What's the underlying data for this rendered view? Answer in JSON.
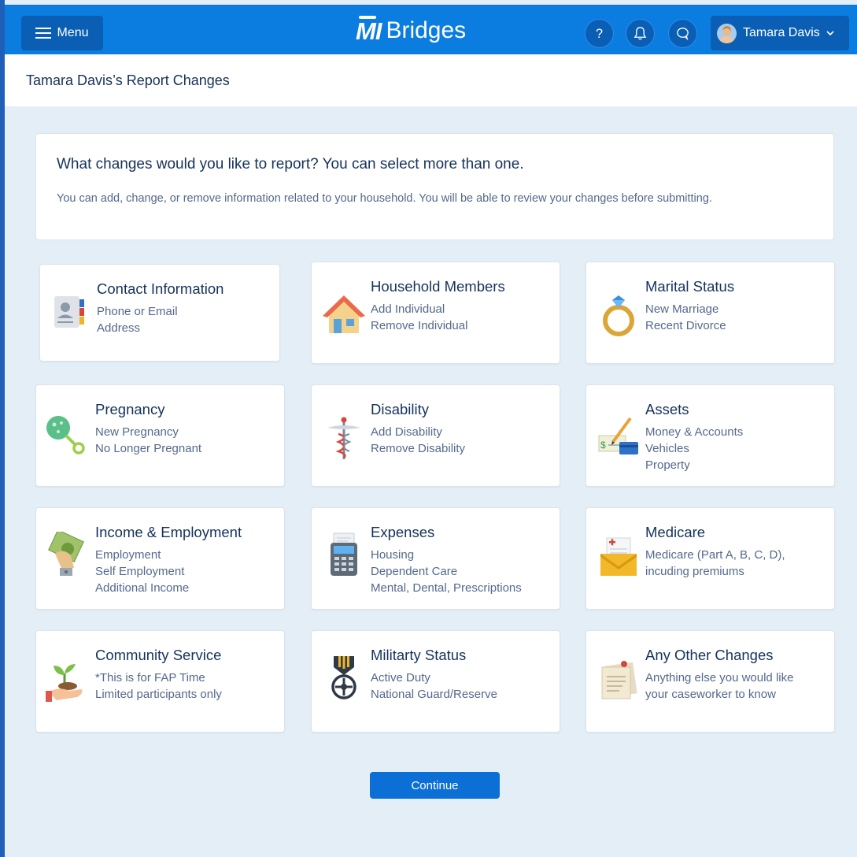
{
  "header": {
    "menu_label": "Menu",
    "logo_mark": "MI",
    "logo_word": "Bridges",
    "help_icon": "question-icon",
    "notifications_icon": "bell-icon",
    "chat_icon": "chat-icon",
    "user_name": "Tamara Davis"
  },
  "page": {
    "title": "Tamara Davis’s Report Changes"
  },
  "intro": {
    "heading": "What changes would you like to report? You can select more than one.",
    "body": "You can add, change, or remove information related to your household. You will be able to review your changes before submitting."
  },
  "cards": [
    {
      "title": "Contact Information",
      "lines": [
        "Phone or Email",
        "Address"
      ],
      "icon": "contact-card-icon"
    },
    {
      "title": "Household Members",
      "lines": [
        "Add Individual",
        "Remove Individual"
      ],
      "icon": "house-icon"
    },
    {
      "title": "Marital Status",
      "lines": [
        "New Marriage",
        "Recent Divorce"
      ],
      "icon": "ring-icon"
    },
    {
      "title": "Pregnancy",
      "lines": [
        "New Pregnancy",
        "No Longer Pregnant"
      ],
      "icon": "baby-rattle-icon"
    },
    {
      "title": "Disability",
      "lines": [
        "Add Disability",
        "Remove Disability"
      ],
      "icon": "caduceus-icon"
    },
    {
      "title": "Assets",
      "lines": [
        "Money & Accounts",
        "Vehicles",
        "Property"
      ],
      "icon": "check-and-card-icon"
    },
    {
      "title": "Income & Employment",
      "lines": [
        "Employment",
        "Self Employment",
        "Additional Income"
      ],
      "icon": "money-hand-icon"
    },
    {
      "title": "Expenses",
      "lines": [
        "Housing",
        "Dependent Care",
        "Mental, Dental, Prescriptions"
      ],
      "icon": "payment-terminal-icon"
    },
    {
      "title": "Medicare",
      "lines": [
        "Medicare (Part A, B, C, D),",
        "incuding premiums"
      ],
      "icon": "medical-envelope-icon"
    },
    {
      "title": "Community Service",
      "lines": [
        "*This is for FAP Time",
        "Limited participants only"
      ],
      "icon": "plant-hand-icon"
    },
    {
      "title": "Militarty Status",
      "lines": [
        "Active Duty",
        "National Guard/Reserve"
      ],
      "icon": "military-medal-icon"
    },
    {
      "title": "Any Other Changes",
      "lines": [
        "Anything else you would like",
        "your caseworker to know"
      ],
      "icon": "note-icon"
    }
  ],
  "continue_label": "Continue"
}
